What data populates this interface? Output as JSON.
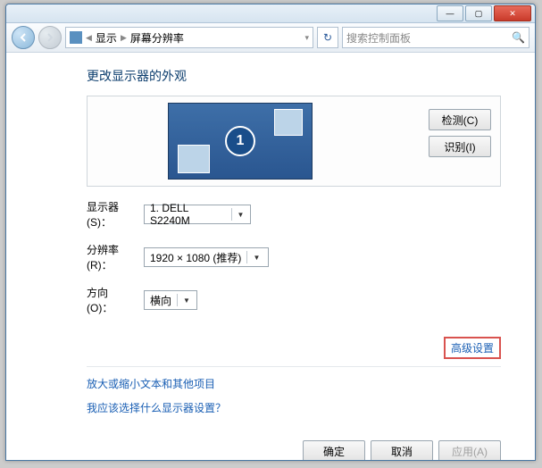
{
  "titlebar": {
    "min": "—",
    "max": "▢",
    "close": "✕"
  },
  "breadcrumb": {
    "seg1": "显示",
    "seg2": "屏幕分辨率"
  },
  "search": {
    "placeholder": "搜索控制面板"
  },
  "heading": "更改显示器的外观",
  "preview": {
    "number": "1"
  },
  "buttons": {
    "detect": "检测(C)",
    "identify": "识别(I)"
  },
  "form": {
    "display_label": "显示器(S)：",
    "display_value": "1. DELL S2240M",
    "resolution_label": "分辨率(R)：",
    "resolution_value": "1920 × 1080 (推荐)",
    "orientation_label": "方向(O)：",
    "orientation_value": "横向"
  },
  "links": {
    "advanced": "高级设置",
    "textsize": "放大或缩小文本和其他项目",
    "which_settings": "我应该选择什么显示器设置？"
  },
  "footer": {
    "ok": "确定",
    "cancel": "取消",
    "apply": "应用(A)"
  }
}
